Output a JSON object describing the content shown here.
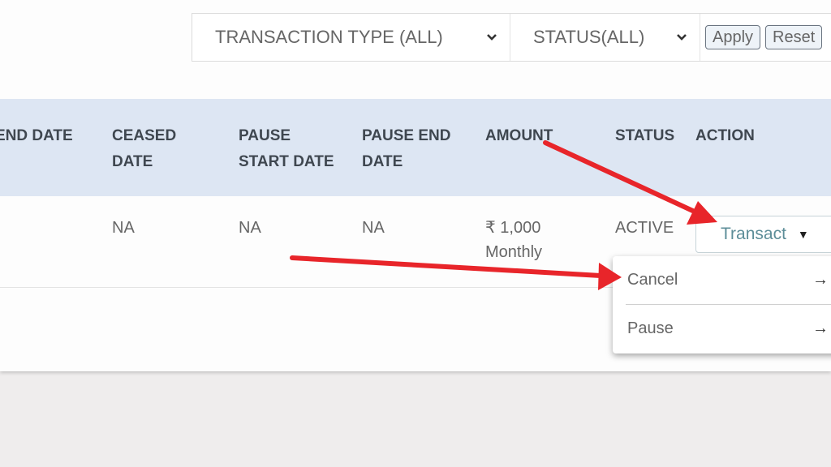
{
  "filters": {
    "transaction_type": {
      "selected": "TRANSACTION TYPE (ALL)",
      "icon": "chevron-down-icon"
    },
    "status": {
      "selected": "STATUS(ALL)",
      "icon": "chevron-down-icon"
    },
    "apply_label": "Apply",
    "reset_label": "Reset"
  },
  "table": {
    "headers": [
      {
        "line1": "END DATE",
        "line2": ""
      },
      {
        "line1": "CEASED",
        "line2": "DATE"
      },
      {
        "line1": "PAUSE",
        "line2": "START DATE"
      },
      {
        "line1": "PAUSE END",
        "line2": "DATE"
      },
      {
        "line1": "AMOUNT",
        "line2": ""
      },
      {
        "line1": "STATUS",
        "line2": ""
      },
      {
        "line1": "ACTION",
        "line2": ""
      }
    ],
    "rows": [
      {
        "end_date": "",
        "ceased_date": "NA",
        "pause_start_date": "NA",
        "pause_end_date": "NA",
        "amount": "₹ 1,000",
        "frequency": "Monthly",
        "status": "ACTIVE",
        "action_label": "Transact"
      }
    ]
  },
  "action_menu": {
    "items": [
      {
        "label": "Cancel",
        "icon": "arrow-right-icon"
      },
      {
        "label": "Pause",
        "icon": "arrow-right-icon"
      }
    ]
  },
  "annotations": {
    "arrow_color": "#e8252a"
  }
}
